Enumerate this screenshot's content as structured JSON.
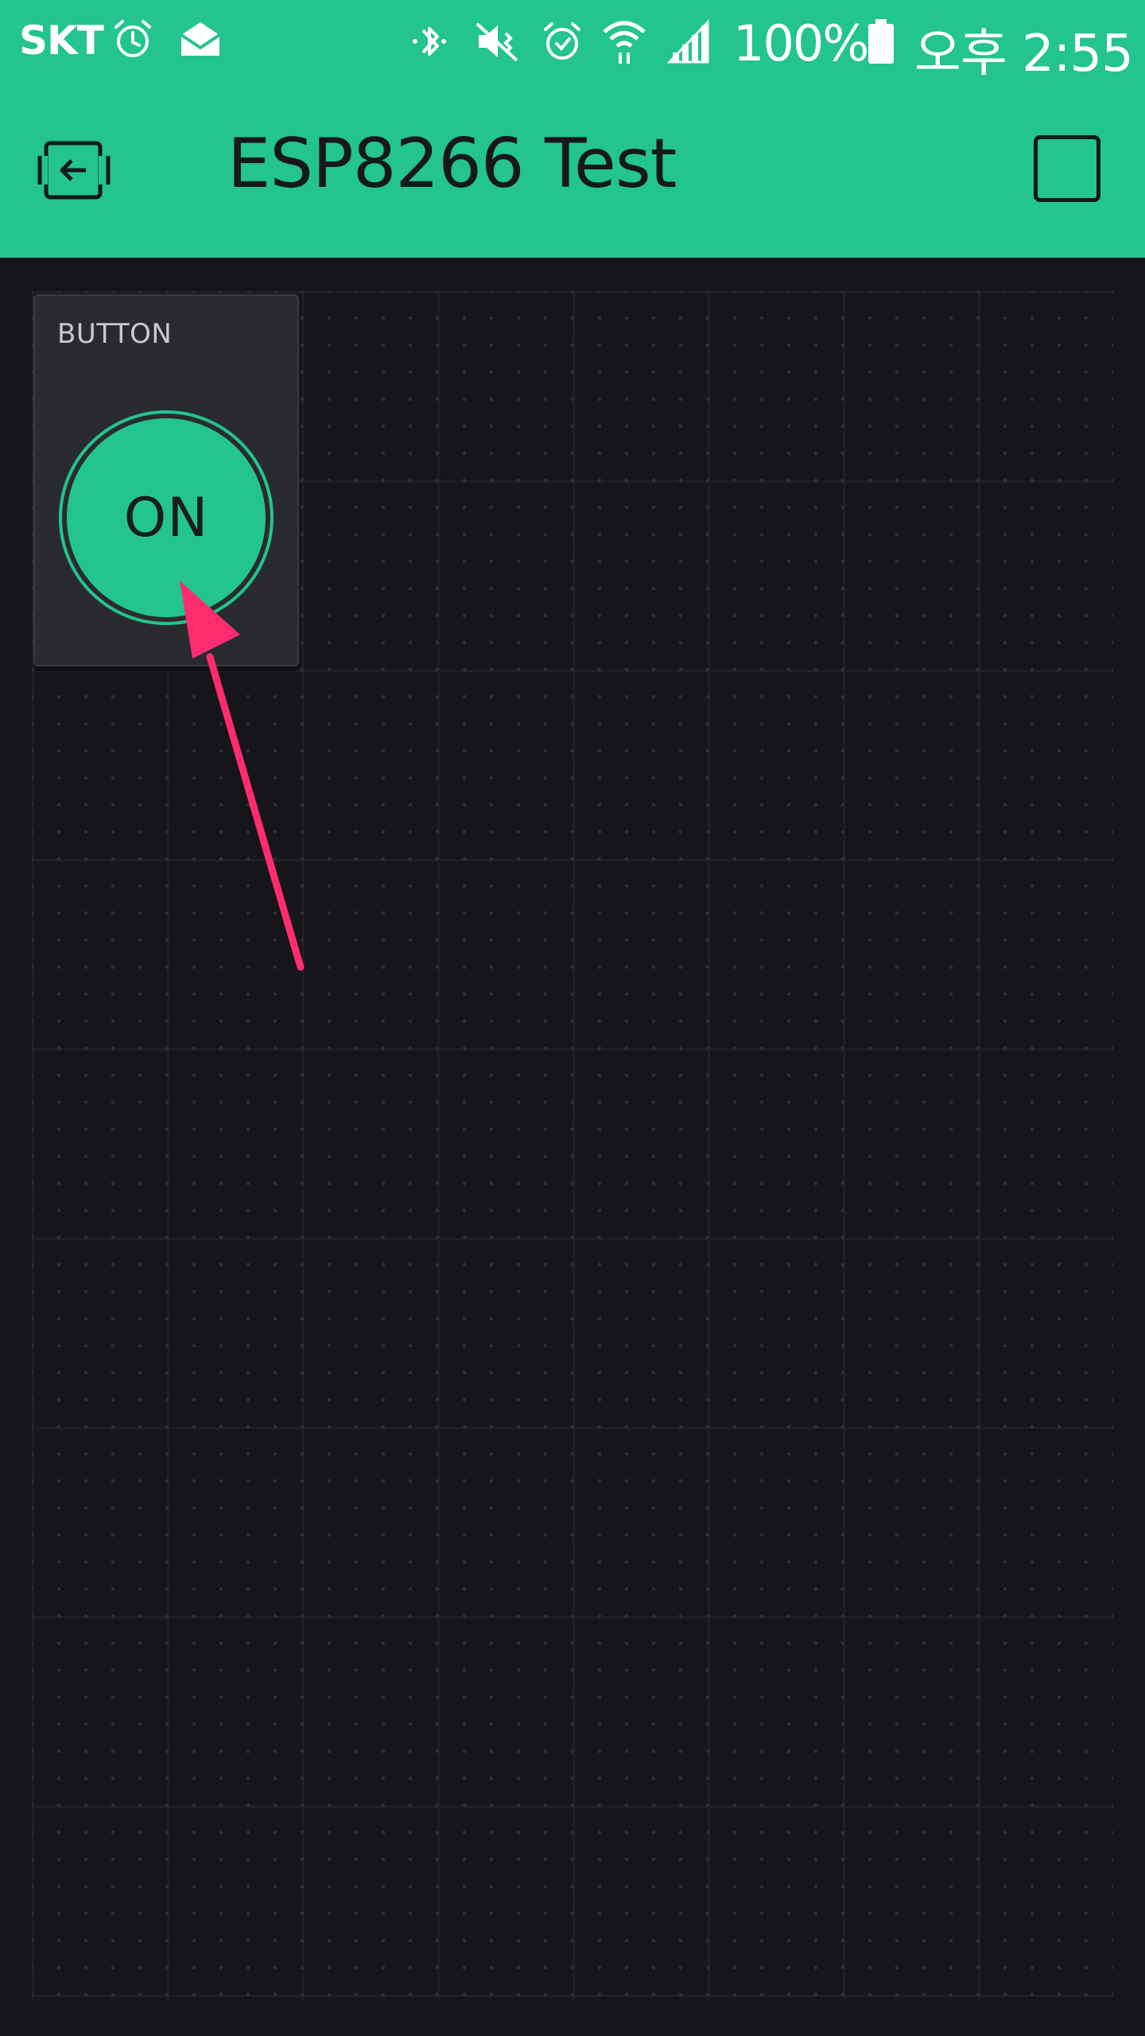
{
  "status_bar": {
    "carrier": "SKT",
    "battery": "100%",
    "time": "오후 2:55",
    "icons": [
      "alarm-icon",
      "mail-icon",
      "bluetooth-icon",
      "mute-icon",
      "alarm-icon",
      "wifi-icon",
      "signal-icon",
      "battery-icon"
    ]
  },
  "header": {
    "title": "ESP8266 Test",
    "back_icon": "exit-icon",
    "stop_icon": "stop-icon"
  },
  "widget": {
    "label": "BUTTON",
    "state": "ON"
  },
  "colors": {
    "accent": "#23c48e",
    "background": "#15151a",
    "widget_bg": "#2a2b2f",
    "annotation": "#ff2d6f"
  }
}
